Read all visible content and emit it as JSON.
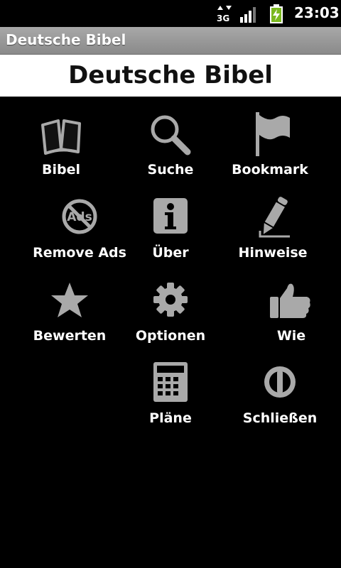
{
  "status_bar": {
    "network": "3G",
    "time": "23:03"
  },
  "app": {
    "title_bar": "Deutsche Bibel",
    "header": "Deutsche Bibel"
  },
  "menu": {
    "items": [
      {
        "label": "Bibel",
        "icon": "book-icon"
      },
      {
        "label": "Suche",
        "icon": "search-icon"
      },
      {
        "label": "Bookmark",
        "icon": "flag-icon"
      },
      {
        "label": "Remove Ads",
        "icon": "no-ads-icon",
        "icon_text": "Ads"
      },
      {
        "label": "Über",
        "icon": "info-icon"
      },
      {
        "label": "Hinweise",
        "icon": "pencil-icon"
      },
      {
        "label": "Bewerten",
        "icon": "star-icon"
      },
      {
        "label": "Optionen",
        "icon": "gear-icon"
      },
      {
        "label": "Wie",
        "icon": "thumbs-up-icon"
      },
      {
        "label": "Pläne",
        "icon": "calendar-icon"
      },
      {
        "label": "Schließen",
        "icon": "power-icon"
      }
    ]
  },
  "colors": {
    "background": "#000000",
    "icon_gray": "#a9a9a9",
    "header_background": "#ffffff",
    "title_bar": "#999999"
  }
}
